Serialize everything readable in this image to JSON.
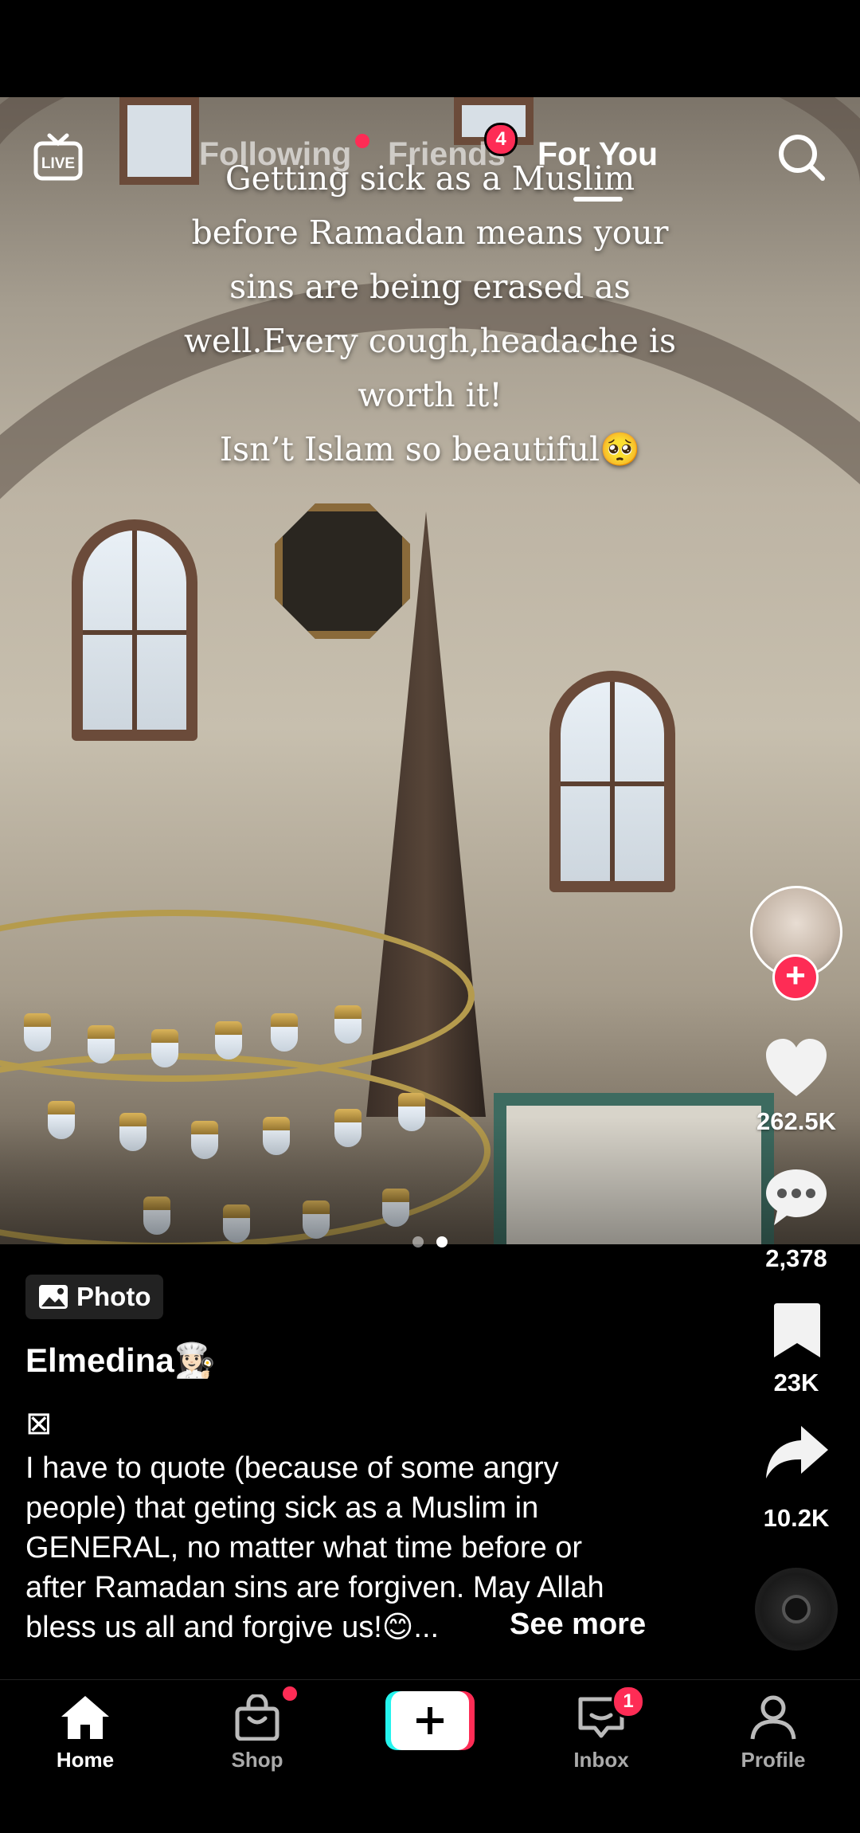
{
  "colors": {
    "accent": "#fe2c55",
    "create_left": "#25f4ee",
    "create_right": "#fe2c55"
  },
  "top_nav": {
    "live_label": "LIVE",
    "tabs": [
      {
        "label": "Following",
        "has_dot": true
      },
      {
        "label": "Friends",
        "badge": "4"
      },
      {
        "label": "For You",
        "active": true
      }
    ],
    "search_icon": "search-icon"
  },
  "overlay_text": "Getting sick as a Muslim\nbefore Ramadan means your\nsins are being erased as\nwell.Every cough,headache is\nworth it!\nIsn’t Islam so beautiful🥺",
  "carousel": {
    "count": 2,
    "active_index": 1
  },
  "actions": {
    "likes": "262.5K",
    "comments": "2,378",
    "saves": "23K",
    "shares": "10.2K"
  },
  "post": {
    "type_badge": "Photo",
    "username": "Elmedina👩🏻‍🍳",
    "caption_glyph": "⊠",
    "caption": "I have to quote (because of some angry\npeople) that geting sick as a Muslim in\nGENERAL, no matter what time before or\nafter Ramadan sins are forgiven. May Allah\nbless us all and forgive us!😊...",
    "see_more": "See more"
  },
  "bottom_nav": {
    "items": [
      {
        "label": "Home",
        "active": true
      },
      {
        "label": "Shop",
        "has_dot": true
      },
      {
        "label": ""
      },
      {
        "label": "Inbox",
        "badge": "1"
      },
      {
        "label": "Profile"
      }
    ]
  }
}
